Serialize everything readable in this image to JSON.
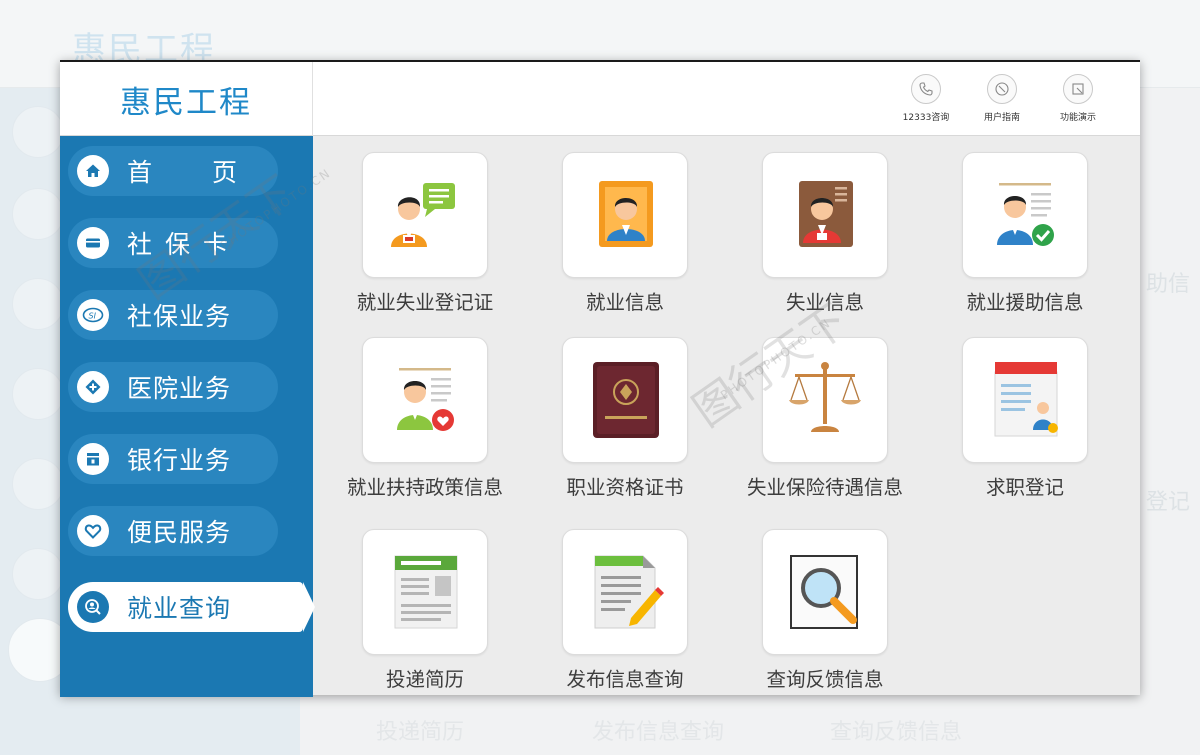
{
  "app": {
    "title": "惠民工程"
  },
  "top_actions": [
    {
      "label": "12333咨询",
      "icon": "phone-icon"
    },
    {
      "label": "用户指南",
      "icon": "compass-icon"
    },
    {
      "label": "功能演示",
      "icon": "demo-icon"
    }
  ],
  "sidebar": {
    "items": [
      {
        "label": "首 页",
        "icon": "home-icon",
        "active": false
      },
      {
        "label": "社保卡",
        "icon": "card-icon",
        "active": false
      },
      {
        "label": "社保业务",
        "icon": "si-icon",
        "active": false
      },
      {
        "label": "医院业务",
        "icon": "hospital-icon",
        "active": false
      },
      {
        "label": "银行业务",
        "icon": "bank-icon",
        "active": false
      },
      {
        "label": "便民服务",
        "icon": "heart-icon",
        "active": false
      },
      {
        "label": "就业查询",
        "icon": "search-person-icon",
        "active": true
      }
    ]
  },
  "tiles": [
    {
      "label": "就业失业登记证",
      "icon": "registration-card-icon"
    },
    {
      "label": "就业信息",
      "icon": "employment-info-icon"
    },
    {
      "label": "失业信息",
      "icon": "unemployment-info-icon"
    },
    {
      "label": "就业援助信息",
      "icon": "employment-aid-icon"
    },
    {
      "label": "就业扶持政策信息",
      "icon": "support-policy-icon"
    },
    {
      "label": "职业资格证书",
      "icon": "certificate-icon"
    },
    {
      "label": "失业保险待遇信息",
      "icon": "scales-icon"
    },
    {
      "label": "求职登记",
      "icon": "job-application-icon"
    },
    {
      "label": "投递简历",
      "icon": "resume-icon"
    },
    {
      "label": "发布信息查询",
      "icon": "document-edit-icon"
    },
    {
      "label": "查询反馈信息",
      "icon": "magnifier-icon"
    }
  ],
  "background": {
    "bottom_labels": [
      "投递简历",
      "发布信息查询",
      "查询反馈信息"
    ],
    "right_labels": [
      "助信",
      "登记"
    ]
  },
  "colors": {
    "brand_blue": "#1b78b2",
    "logo_blue": "#1f88c8",
    "content_bg": "#ececec"
  },
  "watermark": {
    "text": "图行天下",
    "sub": "PHOTOPHOTO.CN"
  }
}
